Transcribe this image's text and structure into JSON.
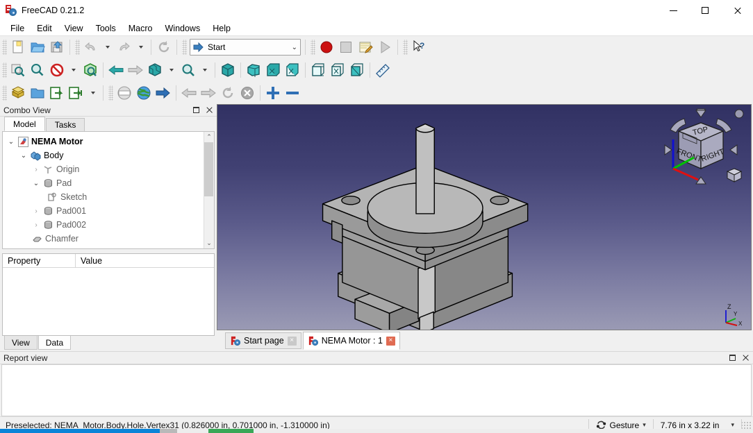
{
  "window": {
    "title": "FreeCAD 0.21.2",
    "app_icon": "freecad-icon",
    "minimize_label": "Minimize",
    "maximize_label": "Maximize",
    "close_label": "Close"
  },
  "menubar": {
    "items": [
      {
        "label": "File",
        "name": "menu-file"
      },
      {
        "label": "Edit",
        "name": "menu-edit"
      },
      {
        "label": "View",
        "name": "menu-view"
      },
      {
        "label": "Tools",
        "name": "menu-tools"
      },
      {
        "label": "Macro",
        "name": "menu-macro"
      },
      {
        "label": "Windows",
        "name": "menu-windows"
      },
      {
        "label": "Help",
        "name": "menu-help"
      }
    ]
  },
  "toolbar": {
    "workbench_selector": {
      "value": "Start",
      "icon": "blue-arrow-icon",
      "dropdown_glyph": "⌄"
    },
    "row1": [
      {
        "name": "new-document-button",
        "icon": "new-file-icon",
        "tooltip": "New"
      },
      {
        "name": "open-document-button",
        "icon": "open-folder-icon",
        "tooltip": "Open"
      },
      {
        "name": "save-document-button",
        "icon": "save-icon",
        "tooltip": "Save"
      },
      {
        "name": "undo-button",
        "icon": "undo-arrow-icon",
        "tooltip": "Undo"
      },
      {
        "name": "undo-dropdown",
        "icon": "caret-down-icon",
        "tooltip": "Undo history"
      },
      {
        "name": "redo-button",
        "icon": "redo-arrow-icon",
        "tooltip": "Redo"
      },
      {
        "name": "redo-dropdown",
        "icon": "caret-down-icon",
        "tooltip": "Redo history"
      },
      {
        "name": "refresh-button",
        "icon": "refresh-icon",
        "tooltip": "Refresh"
      },
      {
        "name": "macro-record-button",
        "icon": "record-circle-icon",
        "tooltip": "Macro recording"
      },
      {
        "name": "macro-stop-button",
        "icon": "stop-square-icon",
        "tooltip": "Stop macro recording"
      },
      {
        "name": "macro-edit-button",
        "icon": "notepad-pencil-icon",
        "tooltip": "Macros"
      },
      {
        "name": "macro-execute-button",
        "icon": "play-triangle-icon",
        "tooltip": "Execute macro"
      },
      {
        "name": "whats-this-button",
        "icon": "cursor-question-icon",
        "tooltip": "What's this?"
      }
    ],
    "row2": [
      {
        "name": "fit-all-button",
        "icon": "fit-all-icon",
        "tooltip": "Fit all"
      },
      {
        "name": "fit-selection-button",
        "icon": "fit-selection-icon",
        "tooltip": "Fit selection"
      },
      {
        "name": "draw-style-button",
        "icon": "no-entry-icon",
        "tooltip": "Draw style"
      },
      {
        "name": "draw-style-dropdown",
        "icon": "caret-down-icon",
        "tooltip": "Draw style options"
      },
      {
        "name": "selection-view-button",
        "icon": "green-box-icon",
        "tooltip": "Selection view"
      },
      {
        "name": "view-back-button",
        "icon": "left-arrow-icon",
        "tooltip": "Back"
      },
      {
        "name": "view-forward-button",
        "icon": "right-arrow-icon",
        "tooltip": "Forward"
      },
      {
        "name": "std-views-button",
        "icon": "views-cube-icon",
        "tooltip": "Standard views"
      },
      {
        "name": "std-views-dropdown",
        "icon": "caret-down-icon",
        "tooltip": "Standard views list"
      },
      {
        "name": "zoom-button",
        "icon": "magnifier-icon",
        "tooltip": "Zoom"
      },
      {
        "name": "zoom-dropdown",
        "icon": "caret-down-icon",
        "tooltip": "Zoom options"
      },
      {
        "name": "isometric-view-button",
        "icon": "isometric-cube-icon",
        "tooltip": "Axonometric"
      },
      {
        "name": "front-view-button",
        "icon": "front-view-cube-icon",
        "tooltip": "Front"
      },
      {
        "name": "top-view-button",
        "icon": "top-view-cube-icon",
        "tooltip": "Top"
      },
      {
        "name": "right-view-button",
        "icon": "right-view-cube-icon",
        "tooltip": "Right"
      },
      {
        "name": "rear-view-button",
        "icon": "rear-view-cube-icon",
        "tooltip": "Rear"
      },
      {
        "name": "bottom-view-button",
        "icon": "bottom-view-cube-icon",
        "tooltip": "Bottom"
      },
      {
        "name": "left-view-button",
        "icon": "left-view-cube-icon",
        "tooltip": "Left"
      },
      {
        "name": "measure-button",
        "icon": "ruler-icon",
        "tooltip": "Measure"
      }
    ],
    "row3": [
      {
        "name": "create-part-button",
        "icon": "yellow-part-icon",
        "tooltip": "Create part"
      },
      {
        "name": "create-group-button",
        "icon": "blue-folder-icon",
        "tooltip": "Create group"
      },
      {
        "name": "link-button",
        "icon": "link-out-icon",
        "tooltip": "Make link"
      },
      {
        "name": "link-group-button",
        "icon": "link-group-icon",
        "tooltip": "Make sub-link"
      },
      {
        "name": "link-dropdown",
        "icon": "caret-down-icon",
        "tooltip": "Link options"
      },
      {
        "name": "web-home-button",
        "icon": "globe-blank-icon",
        "tooltip": "Load start page"
      },
      {
        "name": "web-browser-button",
        "icon": "globe-icon",
        "tooltip": "Open website"
      },
      {
        "name": "web-go-button",
        "icon": "blue-right-arrow-icon",
        "tooltip": "Go"
      },
      {
        "name": "web-back-button",
        "icon": "gray-left-arrow-icon",
        "tooltip": "Previous page"
      },
      {
        "name": "web-forward-button",
        "icon": "gray-right-arrow-icon",
        "tooltip": "Next page"
      },
      {
        "name": "web-refresh-button",
        "icon": "refresh-icon",
        "tooltip": "Refresh page"
      },
      {
        "name": "web-stop-button",
        "icon": "stop-x-icon",
        "tooltip": "Stop loading"
      },
      {
        "name": "zoom-in-button",
        "icon": "plus-icon",
        "tooltip": "Zoom in"
      },
      {
        "name": "zoom-out-button",
        "icon": "minus-icon",
        "tooltip": "Zoom out"
      }
    ]
  },
  "combo_view": {
    "title": "Combo View",
    "float_button": "undock-icon",
    "close_button": "close-icon",
    "tabs": [
      {
        "label": "Model",
        "active": true
      },
      {
        "label": "Tasks",
        "active": false
      }
    ],
    "tree": [
      {
        "label": "NEMA Motor",
        "depth": 0,
        "arrow": "down",
        "icon": "document-icon",
        "style": "bold"
      },
      {
        "label": "Body",
        "depth": 1,
        "arrow": "down",
        "icon": "body-icon",
        "style": "normal-dark"
      },
      {
        "label": "Origin",
        "depth": 2,
        "arrow": "right",
        "icon": "origin-icon",
        "style": "gray"
      },
      {
        "label": "Pad",
        "depth": 2,
        "arrow": "down",
        "icon": "pad-icon",
        "style": "gray"
      },
      {
        "label": "Sketch",
        "depth": 3,
        "arrow": "none",
        "icon": "sketch-icon",
        "style": "gray"
      },
      {
        "label": "Pad001",
        "depth": 2,
        "arrow": "right",
        "icon": "pad-icon",
        "style": "gray"
      },
      {
        "label": "Pad002",
        "depth": 2,
        "arrow": "right",
        "icon": "pad-icon",
        "style": "gray"
      },
      {
        "label": "Chamfer",
        "depth": 2,
        "arrow": "none",
        "icon": "chamfer-icon",
        "style": "gray"
      }
    ],
    "property_table": {
      "columns": [
        "Property",
        "Value"
      ],
      "rows": []
    },
    "bottom_tabs": [
      {
        "label": "View",
        "active": false
      },
      {
        "label": "Data",
        "active": true
      }
    ]
  },
  "view3d": {
    "nav_cube": {
      "top_face": "TOP",
      "front_face": "FRONT",
      "right_face": "RIGHT",
      "corner_box": "corner-cube-icon",
      "dot": "home-dot-icon"
    },
    "axis_cross": {
      "x": "X",
      "y": "Y",
      "z": "Z"
    },
    "background_top": "#313163",
    "background_bottom": "#9a9ab4",
    "model_name": "nema-motor-3d-model"
  },
  "document_tabs": [
    {
      "label": "Start page",
      "active": false,
      "close": "×",
      "icon": "freecad-icon"
    },
    {
      "label": "NEMA Motor : 1",
      "active": true,
      "close": "×",
      "icon": "freecad-icon"
    }
  ],
  "report_view": {
    "title": "Report view",
    "float_button": "undock-icon",
    "close_button": "close-icon",
    "lines": []
  },
  "statusbar": {
    "message": "Preselected: NEMA_Motor.Body.Hole.Vertex31 (0.826000 in, 0.701000 in, -1.310000 in)",
    "navigation_style": {
      "label": "Gesture",
      "icon": "gesture-icon",
      "dropdown_glyph": "▾"
    },
    "dimensions": {
      "label": "7.76 in x 3.22 in",
      "dropdown_glyph": "▾"
    }
  },
  "colors": {
    "accent_blue": "#3a7fbf",
    "record_red": "#cc2222",
    "teal_icon": "#2aa8a8",
    "gold_icon": "#d9b43c",
    "window_bg": "#f0f0f0",
    "taskbar_blue": "#0a84d8",
    "taskbar_green": "#3aa757"
  }
}
